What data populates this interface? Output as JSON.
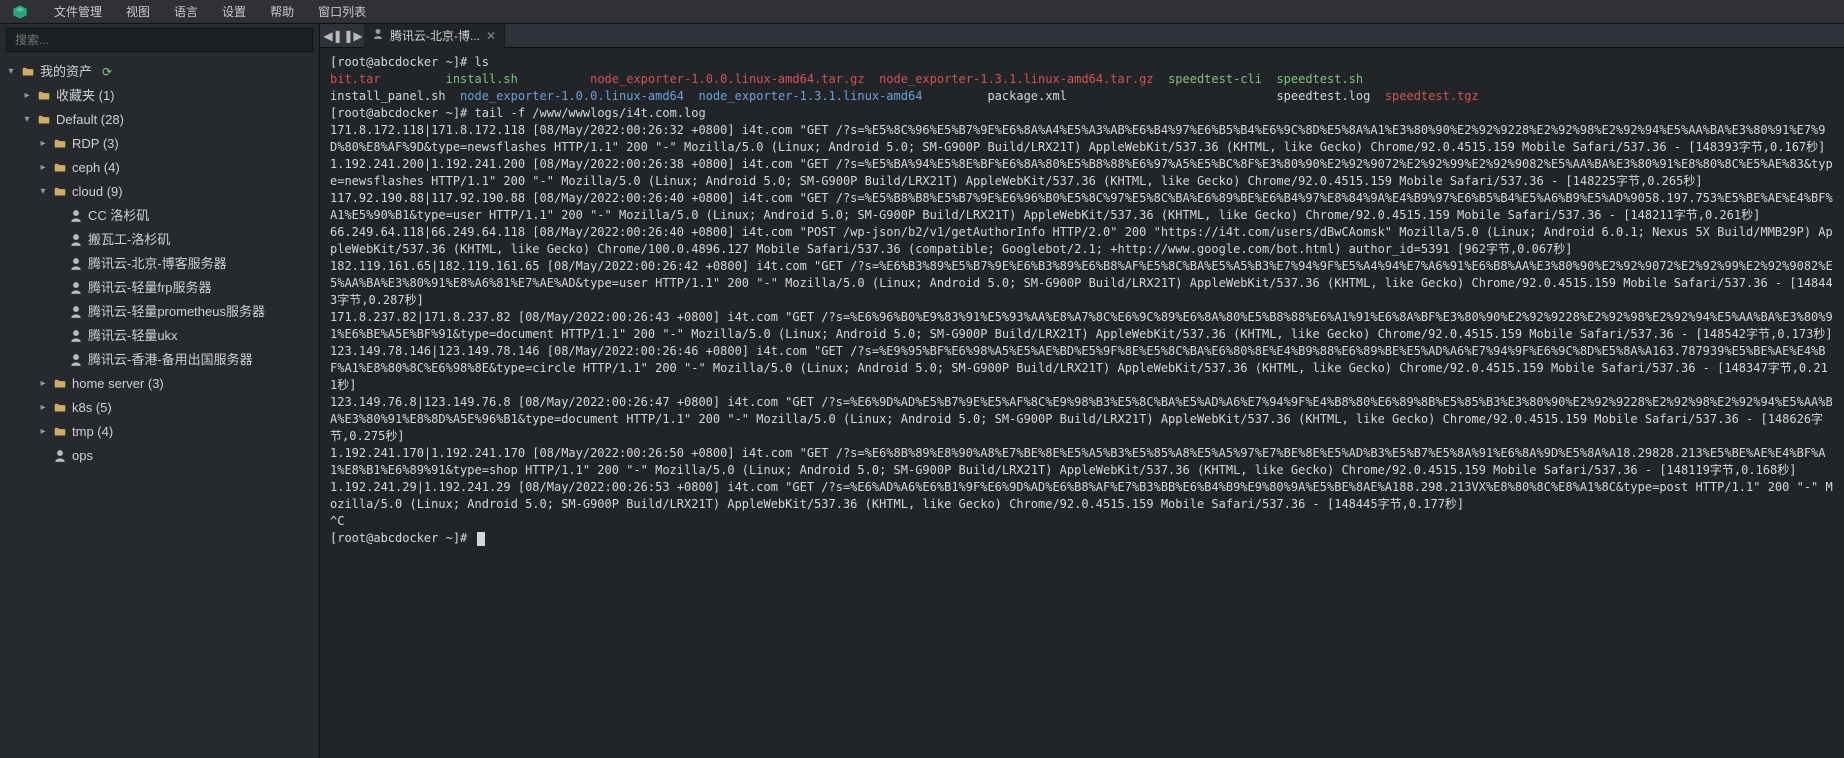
{
  "menubar": {
    "items": [
      "文件管理",
      "视图",
      "语言",
      "设置",
      "帮助",
      "窗口列表"
    ]
  },
  "search": {
    "placeholder": "搜索..."
  },
  "tree": [
    {
      "level": 0,
      "kind": "root",
      "label": "我的资产",
      "arrow": "▾",
      "refresh": true
    },
    {
      "level": 1,
      "kind": "folder",
      "label": "收藏夹 (1)",
      "arrow": "▸"
    },
    {
      "level": 1,
      "kind": "folder",
      "label": "Default (28)",
      "arrow": "▾"
    },
    {
      "level": 2,
      "kind": "folder",
      "label": "RDP (3)",
      "arrow": "▸"
    },
    {
      "level": 2,
      "kind": "folder",
      "label": "ceph (4)",
      "arrow": "▸"
    },
    {
      "level": 2,
      "kind": "folder",
      "label": "cloud (9)",
      "arrow": "▾"
    },
    {
      "level": 3,
      "kind": "host",
      "label": "CC 洛杉矶"
    },
    {
      "level": 3,
      "kind": "host",
      "label": "搬瓦工-洛杉矶"
    },
    {
      "level": 3,
      "kind": "host",
      "label": "腾讯云-北京-博客服务器"
    },
    {
      "level": 3,
      "kind": "host",
      "label": "腾讯云-轻量frp服务器"
    },
    {
      "level": 3,
      "kind": "host",
      "label": "腾讯云-轻量prometheus服务器"
    },
    {
      "level": 3,
      "kind": "host",
      "label": "腾讯云-轻量ukx"
    },
    {
      "level": 3,
      "kind": "host",
      "label": "腾讯云-香港-备用出国服务器"
    },
    {
      "level": 2,
      "kind": "folder",
      "label": "home server (3)",
      "arrow": "▸"
    },
    {
      "level": 2,
      "kind": "folder",
      "label": "k8s (5)",
      "arrow": "▸"
    },
    {
      "level": 2,
      "kind": "folder",
      "label": "tmp (4)",
      "arrow": "▸"
    },
    {
      "level": 2,
      "kind": "host",
      "label": "ops"
    }
  ],
  "tab": {
    "label": "腾讯云-北京-博...",
    "drag_left_title": "拖到左边",
    "drag_right_title": "拖到右边"
  },
  "terminal": {
    "prompt": "[root@abcdocker ~]# ",
    "line0_cmd": "ls",
    "row1": [
      {
        "cls": "red",
        "text": "bit.tar",
        "pad": 16
      },
      {
        "cls": "green",
        "text": "install.sh",
        "pad": 20
      },
      {
        "cls": "red",
        "text": "node_exporter-1.0.0.linux-amd64.tar.gz",
        "pad": 40
      },
      {
        "cls": "red",
        "text": "node_exporter-1.3.1.linux-amd64.tar.gz",
        "pad": 40
      },
      {
        "cls": "green",
        "text": "speedtest-cli",
        "pad": 15
      },
      {
        "cls": "green",
        "text": "speedtest.sh",
        "pad": 0
      }
    ],
    "row2": [
      {
        "cls": "plain",
        "text": "install_panel.sh",
        "pad": 18
      },
      {
        "cls": "blue",
        "text": "node_exporter-1.0.0.linux-amd64",
        "pad": 33
      },
      {
        "cls": "blue",
        "text": "node_exporter-1.3.1.linux-amd64",
        "pad": 40
      },
      {
        "cls": "plain",
        "text": "package.xml",
        "pad": 40
      },
      {
        "cls": "plain",
        "text": "speedtest.log",
        "pad": 15
      },
      {
        "cls": "red",
        "text": "speedtest.tgz",
        "pad": 0
      }
    ],
    "line_tail_cmd": "tail -f /www/wwwlogs/i4t.com.log",
    "log": [
      "171.8.172.118|171.8.172.118 [08/May/2022:00:26:32 +0800] i4t.com \"GET /?s=%E5%8C%96%E5%B7%9E%E6%8A%A4%E5%A3%AB%E6%B4%97%E6%B5%B4%E6%9C%8D%E5%8A%A1%E3%80%90%E2%92%9228%E2%92%98%E2%92%94%E5%AA%BA%E3%80%91%E7%9D%80%E8%AF%9D&type=newsflashes HTTP/1.1\" 200 \"-\" Mozilla/5.0 (Linux; Android 5.0; SM-G900P Build/LRX21T) AppleWebKit/537.36 (KHTML, like Gecko) Chrome/92.0.4515.159 Mobile Safari/537.36 - [148393字节,0.167秒]",
      "1.192.241.200|1.192.241.200 [08/May/2022:00:26:38 +0800] i4t.com \"GET /?s=%E5%BA%94%E5%8E%BF%E6%8A%80%E5%B8%88%E6%97%A5%E5%BC%8F%E3%80%90%E2%92%9072%E2%92%99%E2%92%9082%E5%AA%BA%E3%80%91%E8%80%8C%E5%AE%83&type=newsflashes HTTP/1.1\" 200 \"-\" Mozilla/5.0 (Linux; Android 5.0; SM-G900P Build/LRX21T) AppleWebKit/537.36 (KHTML, like Gecko) Chrome/92.0.4515.159 Mobile Safari/537.36 - [148225字节,0.265秒]",
      "117.92.190.88|117.92.190.88 [08/May/2022:00:26:40 +0800] i4t.com \"GET /?s=%E5%B8%B8%E5%B7%9E%E6%96%B0%E5%8C%97%E5%8C%BA%E6%89%BE%E6%B4%97%E8%84%9A%E4%B9%97%E6%B5%B4%E5%A6%B9%E5%AD%9058.197.753%E5%BE%AE%E4%BF%A1%E5%90%B1&type=user HTTP/1.1\" 200 \"-\" Mozilla/5.0 (Linux; Android 5.0; SM-G900P Build/LRX21T) AppleWebKit/537.36 (KHTML, like Gecko) Chrome/92.0.4515.159 Mobile Safari/537.36 - [148211字节,0.261秒]",
      "66.249.64.118|66.249.64.118 [08/May/2022:00:26:40 +0800] i4t.com \"POST /wp-json/b2/v1/getAuthorInfo HTTP/2.0\" 200 \"https://i4t.com/users/dBwCAomsk\" Mozilla/5.0 (Linux; Android 6.0.1; Nexus 5X Build/MMB29P) AppleWebKit/537.36 (KHTML, like Gecko) Chrome/100.0.4896.127 Mobile Safari/537.36 (compatible; Googlebot/2.1; +http://www.google.com/bot.html) author_id=5391 [962字节,0.067秒]",
      "182.119.161.65|182.119.161.65 [08/May/2022:00:26:42 +0800] i4t.com \"GET /?s=%E6%B3%89%E5%B7%9E%E6%B3%89%E6%B8%AF%E5%8C%BA%E5%A5%B3%E7%94%9F%E5%A4%94%E7%A6%91%E6%B8%AA%E3%80%90%E2%92%9072%E2%92%99%E2%92%9082%E5%AA%BA%E3%80%91%E8%A6%81%E7%AE%AD&type=user HTTP/1.1\" 200 \"-\" Mozilla/5.0 (Linux; Android 5.0; SM-G900P Build/LRX21T) AppleWebKit/537.36 (KHTML, like Gecko) Chrome/92.0.4515.159 Mobile Safari/537.36 - [148443字节,0.287秒]",
      "171.8.237.82|171.8.237.82 [08/May/2022:00:26:43 +0800] i4t.com \"GET /?s=%E6%96%B0%E9%83%91%E5%93%AA%E8%A7%8C%E6%9C%89%E6%8A%80%E5%B8%88%E6%A1%91%E6%8A%BF%E3%80%90%E2%92%9228%E2%92%98%E2%92%94%E5%AA%BA%E3%80%91%E6%BE%A5E%BF%91&type=document HTTP/1.1\" 200 \"-\" Mozilla/5.0 (Linux; Android 5.0; SM-G900P Build/LRX21T) AppleWebKit/537.36 (KHTML, like Gecko) Chrome/92.0.4515.159 Mobile Safari/537.36 - [148542字节,0.173秒]",
      "123.149.78.146|123.149.78.146 [08/May/2022:00:26:46 +0800] i4t.com \"GET /?s=%E9%95%BF%E6%98%A5%E5%AE%BD%E5%9F%8E%E5%8C%BA%E6%80%8E%E4%B9%88%E6%89%BE%E5%AD%A6%E7%94%9F%E6%9C%8D%E5%8A%A163.787939%E5%BE%AE%E4%BF%A1%E8%80%8C%E6%98%8E&type=circle HTTP/1.1\" 200 \"-\" Mozilla/5.0 (Linux; Android 5.0; SM-G900P Build/LRX21T) AppleWebKit/537.36 (KHTML, like Gecko) Chrome/92.0.4515.159 Mobile Safari/537.36 - [148347字节,0.211秒]",
      "123.149.76.8|123.149.76.8 [08/May/2022:00:26:47 +0800] i4t.com \"GET /?s=%E6%9D%AD%E5%B7%9E%E5%AF%8C%E9%98%B3%E5%8C%BA%E5%AD%A6%E7%94%9F%E4%B8%80%E6%89%8B%E5%85%B3%E3%80%90%E2%92%9228%E2%92%98%E2%92%94%E5%AA%BA%E3%80%91%E8%8D%A5E%96%B1&type=document HTTP/1.1\" 200 \"-\" Mozilla/5.0 (Linux; Android 5.0; SM-G900P Build/LRX21T) AppleWebKit/537.36 (KHTML, like Gecko) Chrome/92.0.4515.159 Mobile Safari/537.36 - [148626字节,0.275秒]",
      "1.192.241.170|1.192.241.170 [08/May/2022:00:26:50 +0800] i4t.com \"GET /?s=%E6%8B%89%E8%90%A8%E7%BE%8E%E5%A5%B3%E5%85%A8%E5%A5%97%E7%BE%8E%E5%AD%B3%E5%B7%E5%8A%91%E6%8A%9D%E5%8A%A18.29828.213%E5%BE%AE%E4%BF%A1%E8%B1%E6%89%91&type=shop HTTP/1.1\" 200 \"-\" Mozilla/5.0 (Linux; Android 5.0; SM-G900P Build/LRX21T) AppleWebKit/537.36 (KHTML, like Gecko) Chrome/92.0.4515.159 Mobile Safari/537.36 - [148119字节,0.168秒]",
      "1.192.241.29|1.192.241.29 [08/May/2022:00:26:53 +0800] i4t.com \"GET /?s=%E6%AD%A6%E6%B1%9F%E6%9D%AD%E6%B8%AF%E7%B3%BB%E6%B4%B9%E9%80%9A%E5%BE%8AE%A188.298.213VX%E8%80%8C%E8%A1%8C&type=post HTTP/1.1\" 200 \"-\" Mozilla/5.0 (Linux; Android 5.0; SM-G900P Build/LRX21T) AppleWebKit/537.36 (KHTML, like Gecko) Chrome/92.0.4515.159 Mobile Safari/537.36 - [148445字节,0.177秒]"
    ],
    "break_text": "^C"
  }
}
